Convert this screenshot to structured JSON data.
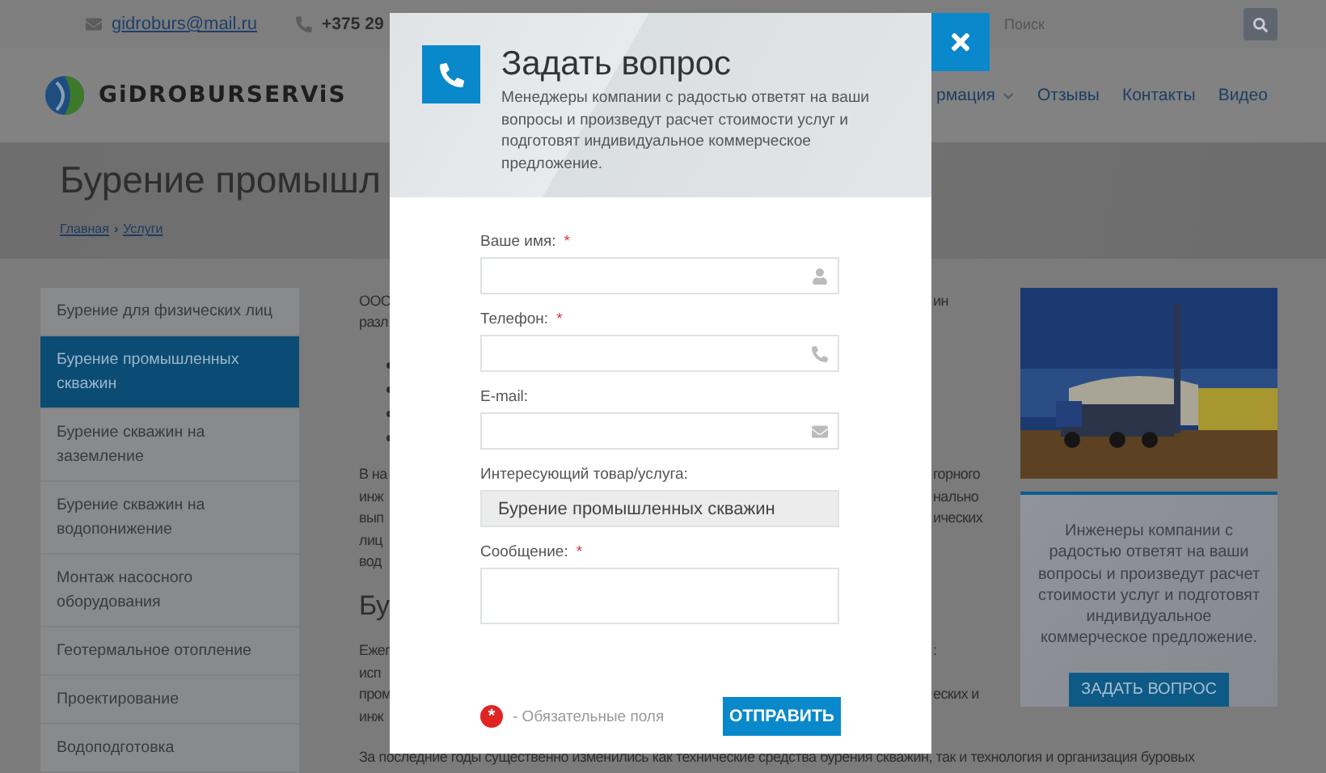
{
  "topbar": {
    "email": "gidroburs@mail.ru",
    "phone": "+375 29",
    "search": {
      "placeholder": "Поиск"
    }
  },
  "header": {
    "logo_text": "GiDROBURSERViS",
    "nav": [
      {
        "label": "рмация",
        "has_menu": true
      },
      {
        "label": "Отзывы",
        "has_menu": false
      },
      {
        "label": "Контакты",
        "has_menu": false
      },
      {
        "label": "Видео",
        "has_menu": false
      }
    ]
  },
  "hero": {
    "title": "Бурение промышл",
    "breadcrumbs": [
      "Главная",
      "Услуги"
    ],
    "separator": "›"
  },
  "sidebar": {
    "items": [
      {
        "label": "Бурение для физических лиц",
        "selected": false
      },
      {
        "label": "Бурение промышленных скважин",
        "selected": true
      },
      {
        "label": "Бурение скважин на заземление",
        "selected": false
      },
      {
        "label": "Бурение скважин на водопонижение",
        "selected": false
      },
      {
        "label": "Монтаж насосного оборудования",
        "selected": false
      },
      {
        "label": "Геотермальное отопление",
        "selected": false
      },
      {
        "label": "Проектирование",
        "selected": false
      },
      {
        "label": "Водоподготовка",
        "selected": false
      }
    ]
  },
  "article": {
    "blocks": [
      {
        "kind": "paragraph",
        "lines": [
          {
            "left": "ООС",
            "right": "ин"
          },
          {
            "left": "разл"
          }
        ]
      },
      {
        "kind": "list",
        "lines": [
          {
            "kind": "bullet"
          },
          {
            "kind": "bullet"
          },
          {
            "kind": "bullet"
          },
          {
            "kind": "bullet"
          }
        ]
      },
      {
        "kind": "paragraph",
        "lines": [
          {
            "left": "В на",
            "right": "горного"
          },
          {
            "left": "инж",
            "right": "нально"
          },
          {
            "left": "вып",
            "right": "ических"
          },
          {
            "left": "лиц"
          },
          {
            "left": "вод"
          }
        ]
      },
      {
        "kind": "heading",
        "lines": [
          {
            "left": "Бу"
          }
        ]
      },
      {
        "kind": "paragraph",
        "lines": [
          {
            "left": "Ежег",
            "right": ":"
          },
          {
            "left": "исп"
          },
          {
            "left": "пром",
            "right": "еских и"
          },
          {
            "left": "инж"
          }
        ]
      }
    ],
    "last_line": "За последние годы существенно изменились как технические средства бурения скважин, так и технология и организация буровых"
  },
  "aside": {
    "cta": {
      "text": "Инженеры компании с радостью ответят на ваши вопросы и произведут расчет стоимости услуг и подготовят индивидуальное коммерческое предложение.",
      "button": "ЗАДАТЬ ВОПРОС"
    }
  },
  "modal": {
    "title": "Задать вопрос",
    "description": "Менеджеры компании с радостью ответят на ваши вопросы и произведут расчет стоимости услуг и подготовят индивидуальное коммерческое предложение.",
    "fields": [
      {
        "kind": "name",
        "label": "Ваше имя:",
        "mark": "*"
      },
      {
        "kind": "phone",
        "label": "Телефон:",
        "mark": "*"
      },
      {
        "kind": "email",
        "label": "E-mail:"
      },
      {
        "kind": "readonly",
        "label": "Интересующий товар/услуга:",
        "value": "Бурение промышленных скважин"
      },
      {
        "kind": "message",
        "label": "Сообщение:",
        "mark": "*"
      }
    ],
    "legend": {
      "mark": "*",
      "text": "- Обязательные поля"
    },
    "submit": "ОТПРАВИТЬ"
  }
}
